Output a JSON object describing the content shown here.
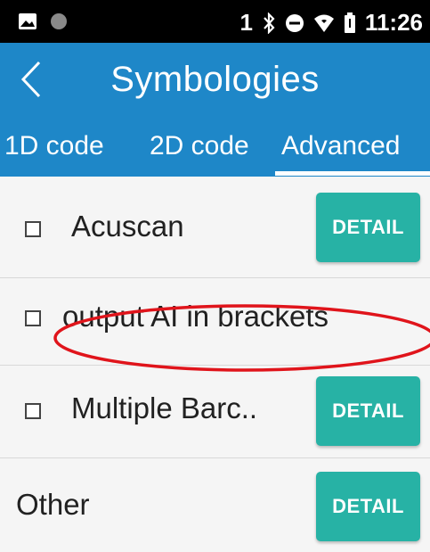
{
  "status_bar": {
    "time": "11:26",
    "sim_slot": "1",
    "icons": [
      "image-icon",
      "dot-icon",
      "bluetooth-icon",
      "minus-circle-icon",
      "wifi-icon",
      "battery-icon"
    ]
  },
  "app_bar": {
    "back_icon": "chevron-left-icon",
    "title": "Symbologies"
  },
  "tabs": [
    {
      "label": "1D code",
      "selected": false
    },
    {
      "label": "2D code",
      "selected": false
    },
    {
      "label": "Advanced",
      "selected": true
    }
  ],
  "list": {
    "items": [
      {
        "label": "Acuscan",
        "checked": false,
        "has_detail": true,
        "detail_label": "DETAIL"
      },
      {
        "label": "output AI in brackets",
        "checked": false,
        "has_detail": false
      },
      {
        "label": "Multiple Barc..",
        "checked": false,
        "has_detail": true,
        "detail_label": "DETAIL"
      },
      {
        "label": "Other",
        "checked": null,
        "has_detail": true,
        "detail_label": "DETAIL"
      }
    ]
  },
  "colors": {
    "primary": "#1e87c8",
    "accent": "#27b2a5",
    "annotation": "#e0141b",
    "background": "#f5f5f5"
  }
}
